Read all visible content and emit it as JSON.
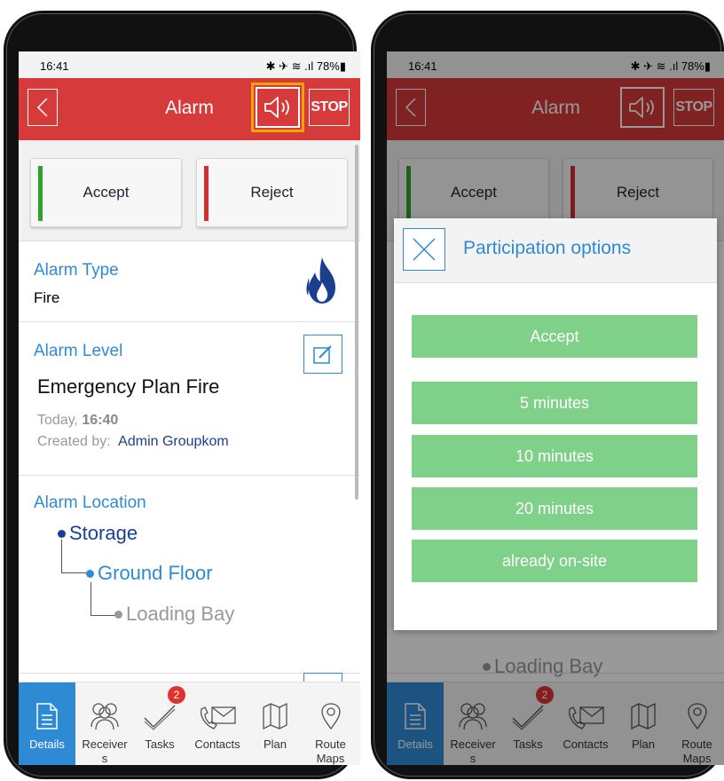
{
  "status_bar": {
    "time": "16:41",
    "icons": "✱ ✈ ≋ .ıl 78%▮"
  },
  "header": {
    "title": "Alarm",
    "stop_label": "STOP"
  },
  "buttons": {
    "accept": "Accept",
    "reject": "Reject"
  },
  "alarm_type": {
    "title": "Alarm Type",
    "value": "Fire"
  },
  "alarm_level": {
    "title": "Alarm Level",
    "value": "Emergency Plan Fire",
    "date_prefix": "Today,",
    "time": "16:40",
    "created_by_label": "Created by:",
    "created_by": "Admin Groupkom"
  },
  "alarm_location": {
    "title": "Alarm Location",
    "items": [
      "Storage",
      "Ground Floor",
      "Loading Bay"
    ]
  },
  "tabs": [
    {
      "label": "Details",
      "icon": "document-icon"
    },
    {
      "label": "Receiver\ns",
      "icon": "people-icon"
    },
    {
      "label": "Tasks",
      "icon": "checkmark-icon",
      "badge": "2"
    },
    {
      "label": "Contacts",
      "icon": "phone-mail-icon"
    },
    {
      "label": "Plan",
      "icon": "map-icon"
    },
    {
      "label": "Route\nMaps",
      "icon": "location-pin-icon"
    }
  ],
  "modal": {
    "title": "Participation options",
    "options": [
      "Accept",
      "5 minutes",
      "10 minutes",
      "20 minutes",
      "already on-site"
    ]
  },
  "colors": {
    "header_red": "#d63a3a",
    "accent_blue": "#2f8ad6",
    "accept_green": "#2aa52a",
    "reject_red": "#d32f2f",
    "option_green": "#7fd089",
    "highlight_orange": "#f0a500"
  }
}
